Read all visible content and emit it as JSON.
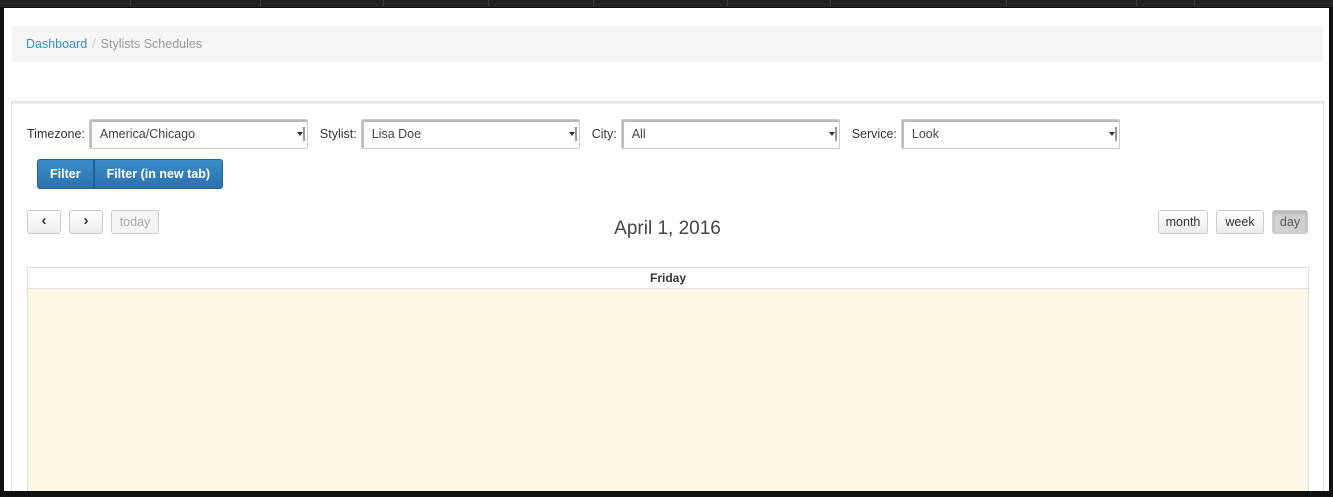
{
  "breadcrumb": {
    "home": "Dashboard",
    "separator": "/",
    "current": "Stylists Schedules"
  },
  "filters": {
    "timezone": {
      "label": "Timezone:",
      "value": "America/Chicago"
    },
    "stylist": {
      "label": "Stylist:",
      "value": "Lisa Doe"
    },
    "city": {
      "label": "City:",
      "value": "All"
    },
    "service": {
      "label": "Service:",
      "value": "Look"
    }
  },
  "actions": {
    "filter": "Filter",
    "filter_new_tab": "Filter (in new tab)"
  },
  "calendar": {
    "prev": "‹",
    "next": "›",
    "today": "today",
    "title": "April 1, 2016",
    "views": {
      "month": "month",
      "week": "week",
      "day": "day"
    },
    "active_view": "day",
    "day_header": "Friday",
    "highlight_color": "#fcf8e3"
  },
  "colors": {
    "link": "#3a8fc7",
    "primary": "#2a72ad"
  }
}
